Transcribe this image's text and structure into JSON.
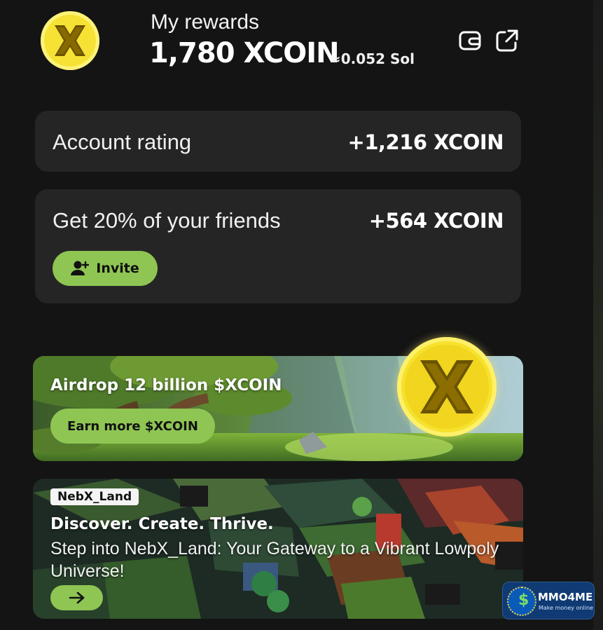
{
  "header": {
    "title": "My rewards",
    "balance": "1,780 XCOIN",
    "sol_equivalent": "≈0.052 Sol",
    "icons": [
      "coin-logo-icon",
      "wallet-icon",
      "external-link-icon"
    ]
  },
  "cards": {
    "account_rating": {
      "label": "Account rating",
      "value": "+1,216 XCOIN"
    },
    "friends": {
      "label": "Get 20% of your friends",
      "value": "+564 XCOIN",
      "invite_label": "Invite"
    }
  },
  "airdrop": {
    "title": "Airdrop 12 billion $XCOIN",
    "button_label": "Earn more $XCOIN"
  },
  "nebx": {
    "tag": "NebX_Land",
    "headline": "Discover. Create. Thrive.",
    "description": "Step into NebX_Land: Your Gateway to a Vibrant Lowpoly Universe!"
  },
  "watermark": {
    "name": "MMO4ME",
    "tagline": "Make money online"
  },
  "colors": {
    "accent_green": "#8fc553",
    "card_bg": "#252525",
    "page_bg": "#141414",
    "coin_yellow": "#f6e234"
  }
}
